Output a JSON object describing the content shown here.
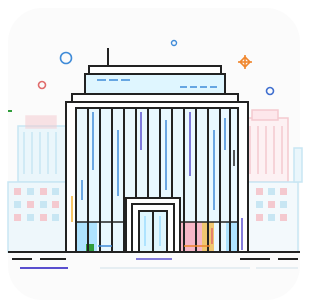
{
  "illustration": {
    "subject": "office-building-icon",
    "palette": {
      "outline": "#222222",
      "glass_blue": "#aee3ff",
      "glass_light": "#dff6ff",
      "accent_blue": "#3f8bd8",
      "accent_red": "#e06b6b",
      "accent_orange": "#f0872e",
      "accent_pink": "#f7b7c8",
      "accent_green": "#2f9d3b",
      "accent_yellow": "#f2b233",
      "accent_purple": "#5a4fcf",
      "ghost_blue": "#c8e6f3",
      "ghost_pink": "#f4c9cf",
      "card_bg": "#fbfbfb"
    }
  }
}
